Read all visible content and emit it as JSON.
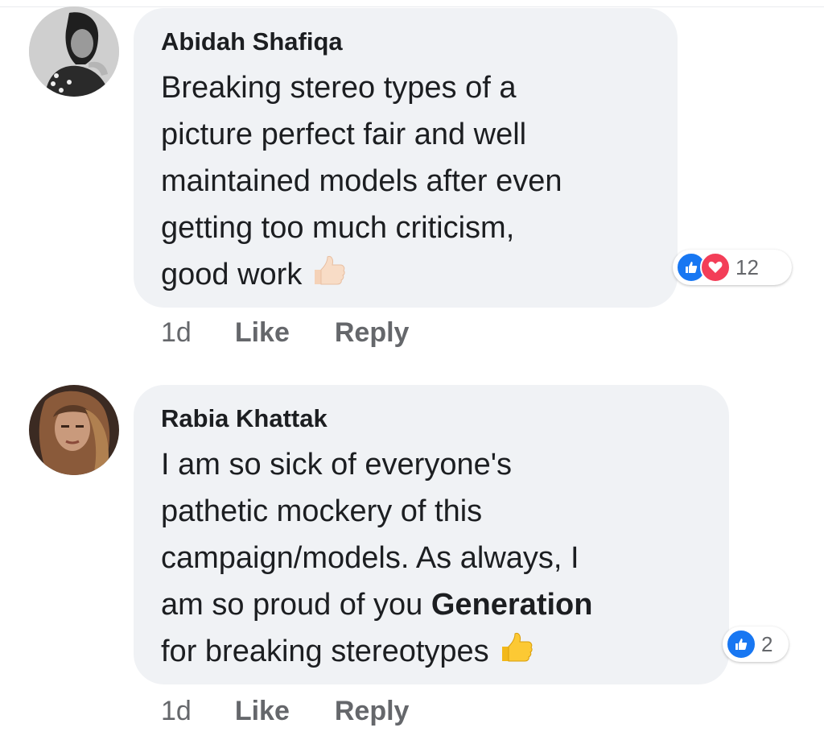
{
  "comments": [
    {
      "author": "Abidah Shafiqa",
      "lines": [
        "Breaking stereo types of a",
        "picture perfect fair and well",
        "maintained models after even",
        "getting too much criticism,",
        "good work"
      ],
      "trailing_emoji": "thumbs-up-light-skin",
      "reactions": {
        "icons": [
          "like-icon",
          "love-icon"
        ],
        "count": "12"
      },
      "time": "1d",
      "like_label": "Like",
      "reply_label": "Reply"
    },
    {
      "author": "Rabia Khattak",
      "lines": [
        "I am so sick of everyone's",
        "pathetic mockery of this",
        "campaign/models. As always, I",
        "am so proud of you ",
        "for breaking stereotypes"
      ],
      "bold_mention": "Generation",
      "trailing_emoji": "thumbs-up-yellow",
      "reactions": {
        "icons": [
          "like-icon"
        ],
        "count": "2"
      },
      "time": "1d",
      "like_label": "Like",
      "reply_label": "Reply"
    }
  ],
  "colors": {
    "bubble": "#f0f2f5",
    "like_blue": "#1877f2",
    "love_red": "#f33e58",
    "meta_gray": "#65676b"
  }
}
